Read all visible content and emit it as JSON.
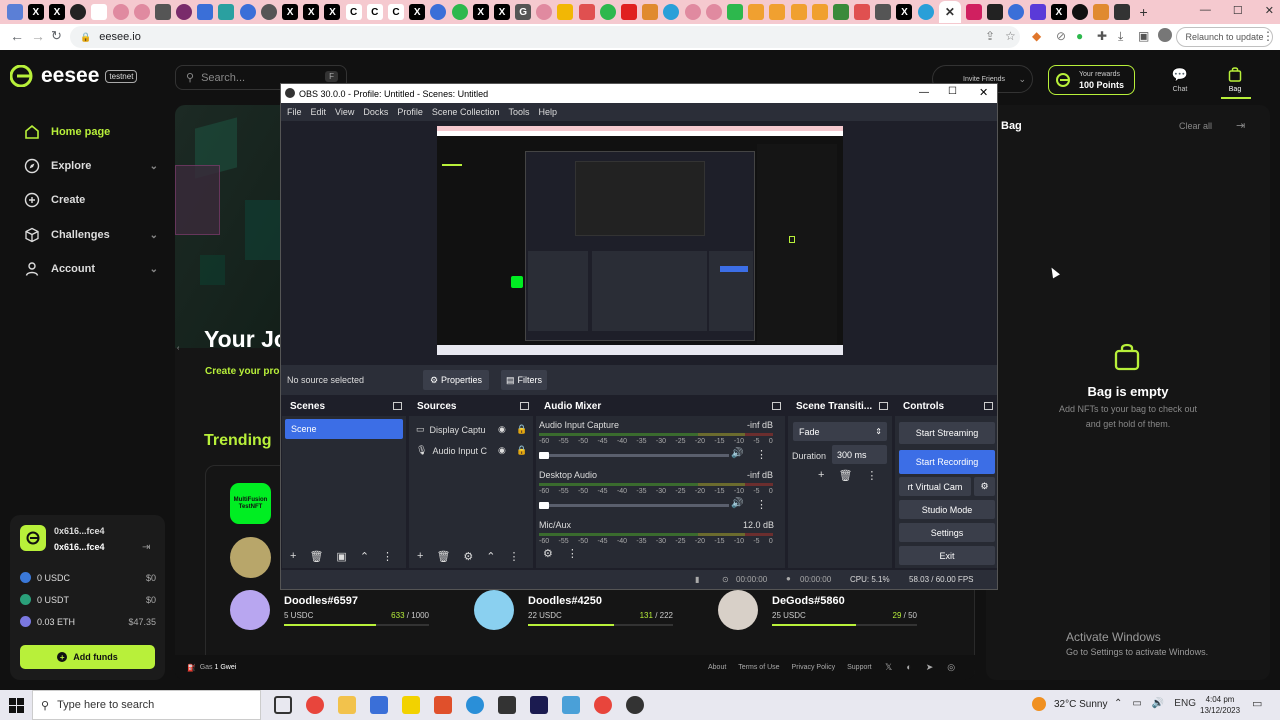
{
  "browser": {
    "url": "eesee.io",
    "relaunch_label": "Relaunch to update"
  },
  "app": {
    "logo_text": "eesee",
    "logo_badge": "testnet",
    "search_placeholder": "Search...",
    "search_shortcut": "F",
    "invite_label": "Invite Friends",
    "rewards_label": "Your rewards",
    "rewards_points": "100 Points",
    "chat_label": "Chat",
    "bag_label": "Bag"
  },
  "sidebar": {
    "items": [
      {
        "label": "Home page",
        "icon": "home-icon"
      },
      {
        "label": "Explore",
        "icon": "compass-icon"
      },
      {
        "label": "Create",
        "icon": "plus-circle-icon"
      },
      {
        "label": "Challenges",
        "icon": "cube-icon"
      },
      {
        "label": "Account",
        "icon": "user-icon"
      }
    ]
  },
  "wallet": {
    "address1": "0x616...fce4",
    "address2": "0x616...fce4",
    "balances": [
      {
        "asset": "0 USDC",
        "value": "$0"
      },
      {
        "asset": "0 USDT",
        "value": "$0"
      },
      {
        "asset": "0.03 ETH",
        "value": "$47.35"
      }
    ],
    "add_funds": "Add funds"
  },
  "main": {
    "hero_title": "Your Jo",
    "hero_sub": "Create your pro",
    "trending": "Trending",
    "card_top_label": "MultiFusion TestNFT",
    "nfts": [
      {
        "name": "Doodles#6597",
        "price": "5 USDC",
        "sold": "633",
        "total": "1000",
        "progress": 0.633
      },
      {
        "name": "Doodles#4250",
        "price": "22 USDC",
        "sold": "131",
        "total": "222",
        "progress": 0.59
      },
      {
        "name": "DeGods#5860",
        "price": "25 USDC",
        "sold": "29",
        "total": "50",
        "progress": 0.58
      }
    ],
    "gas_label": "Gas",
    "gas_value": "1 Gwei",
    "footer_links": [
      "About",
      "Terms of Use",
      "Privacy Policy",
      "Support"
    ]
  },
  "bag": {
    "title": "Bag",
    "clear_all": "Clear all",
    "empty_title": "Bag is empty",
    "empty_line1": "Add NFTs to your bag to check out",
    "empty_line2": "and get hold of them."
  },
  "watermark": {
    "line1": "Activate Windows",
    "line2": "Go to Settings to activate Windows."
  },
  "obs": {
    "title": "OBS 30.0.0 - Profile: Untitled - Scenes: Untitled",
    "menu": [
      "File",
      "Edit",
      "View",
      "Docks",
      "Profile",
      "Scene Collection",
      "Tools",
      "Help"
    ],
    "no_source": "No source selected",
    "properties": "Properties",
    "filters": "Filters",
    "docks": {
      "scenes": "Scenes",
      "sources": "Sources",
      "mixer": "Audio Mixer",
      "transitions": "Scene Transiti...",
      "controls": "Controls"
    },
    "scene_item": "Scene",
    "sources": [
      "Display Captu",
      "Audio Input C"
    ],
    "mixer": [
      {
        "name": "Audio Input Capture",
        "level": "-inf dB"
      },
      {
        "name": "Desktop Audio",
        "level": "-inf dB"
      },
      {
        "name": "Mic/Aux",
        "level": "12.0 dB"
      }
    ],
    "scale": [
      "-60",
      "-55",
      "-50",
      "-45",
      "-40",
      "-35",
      "-30",
      "-25",
      "-20",
      "-15",
      "-10",
      "-5",
      "0"
    ],
    "transition": "Fade",
    "duration_label": "Duration",
    "duration_value": "300 ms",
    "controls": [
      "Start Streaming",
      "Start Recording",
      "rt Virtual Cam",
      "Studio Mode",
      "Settings",
      "Exit"
    ],
    "status": {
      "rec_time": "00:00:00",
      "stream_time": "00:00:00",
      "cpu": "CPU: 5.1%",
      "fps": "58.03 / 60.00 FPS"
    }
  },
  "taskbar": {
    "search_placeholder": "Type here to search",
    "weather": "32°C  Sunny",
    "lang": "ENG",
    "time": "4:04 pm",
    "date": "13/12/2023"
  },
  "colors": {
    "accent": "#b8f03a",
    "obs_blue": "#3c6ee6"
  }
}
